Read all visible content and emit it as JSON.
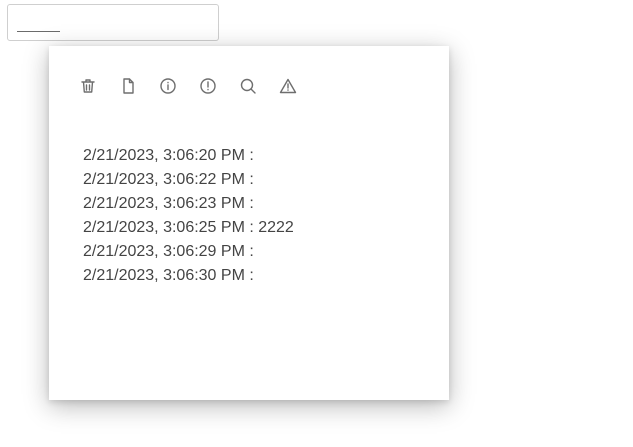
{
  "input": {
    "value": ""
  },
  "toolbar": {
    "icons": [
      {
        "name": "trash-icon"
      },
      {
        "name": "file-icon"
      },
      {
        "name": "info-icon"
      },
      {
        "name": "alert-circle-icon"
      },
      {
        "name": "search-icon"
      },
      {
        "name": "warning-icon"
      }
    ]
  },
  "log": {
    "entries": [
      "2/21/2023, 3:06:20 PM :",
      "2/21/2023, 3:06:22 PM :",
      "2/21/2023, 3:06:23 PM :",
      "2/21/2023, 3:06:25 PM : 2222",
      "2/21/2023, 3:06:29 PM :",
      "2/21/2023, 3:06:30 PM :"
    ]
  }
}
